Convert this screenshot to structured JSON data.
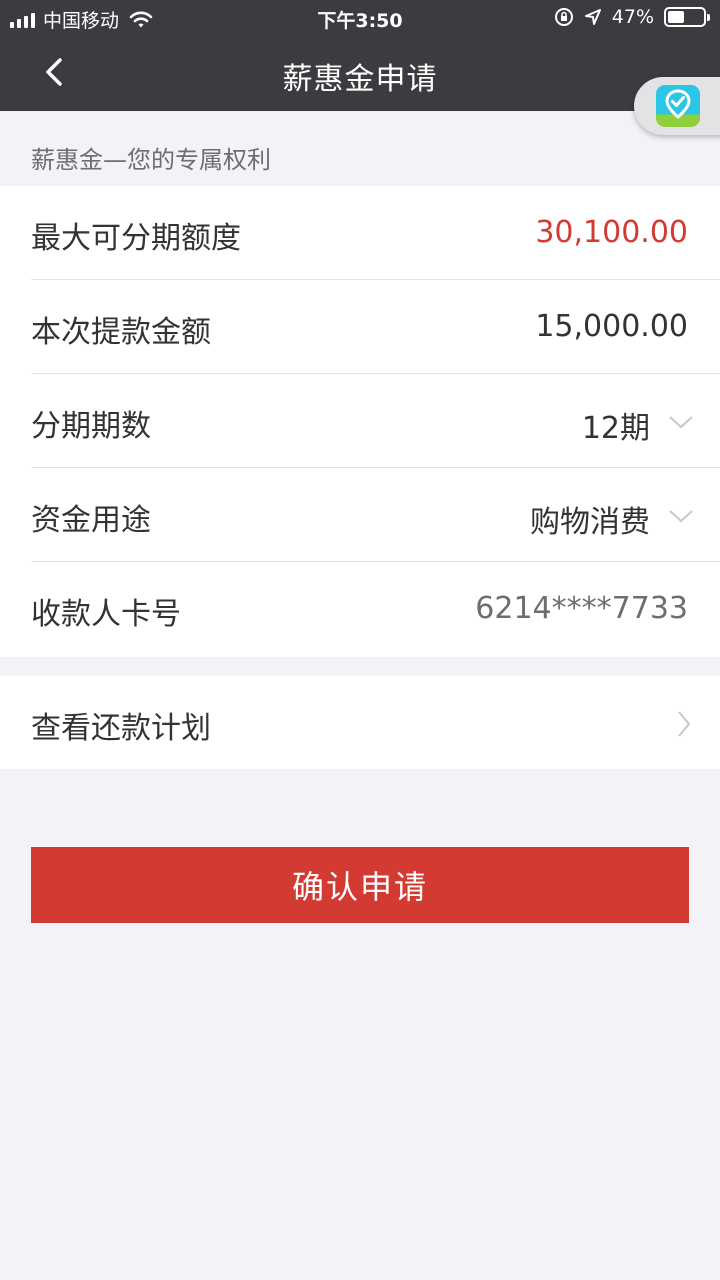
{
  "status_bar": {
    "carrier": "中国移动",
    "time": "下午3:50",
    "battery": "47%",
    "battery_level": 0.47
  },
  "nav": {
    "title": "薪惠金申请"
  },
  "subtitle": "薪惠金—您的专属权利",
  "form": {
    "rows": [
      {
        "label": "最大可分期额度",
        "value": "30,100.00"
      },
      {
        "label": "本次提款金额",
        "value": "15,000.00"
      },
      {
        "label": "分期期数",
        "value": "12期"
      },
      {
        "label": "资金用途",
        "value": "购物消费"
      },
      {
        "label": "收款人卡号",
        "value": "6214****7733"
      }
    ]
  },
  "repayment": {
    "label": "查看还款计划"
  },
  "confirm_label": "确认申请",
  "colors": {
    "accent": "#d33a31",
    "nav_bg": "#3b3c3f",
    "page_bg": "#f2f2f7"
  }
}
